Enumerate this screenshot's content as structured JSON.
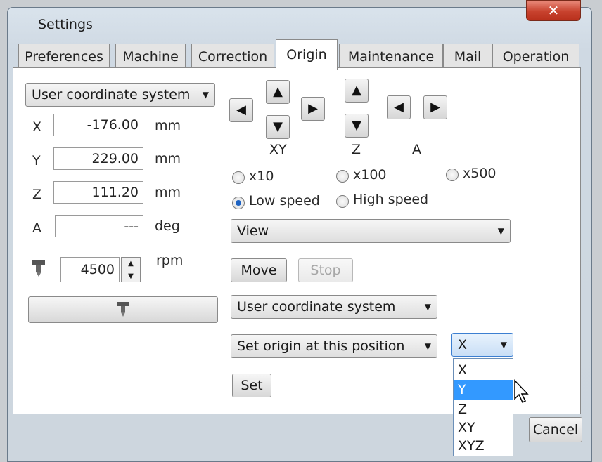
{
  "window": {
    "title": "Settings",
    "close_glyph": "✕"
  },
  "tabs": [
    {
      "label": "Preferences"
    },
    {
      "label": "Machine"
    },
    {
      "label": "Correction"
    },
    {
      "label": "Origin",
      "active": true
    },
    {
      "label": "Maintenance"
    },
    {
      "label": "Mail"
    },
    {
      "label": "Operation"
    }
  ],
  "left": {
    "coord_system": "User coordinate system",
    "axes": [
      {
        "axis": "X",
        "value": "-176.00",
        "unit": "mm"
      },
      {
        "axis": "Y",
        "value": "229.00",
        "unit": "mm"
      },
      {
        "axis": "Z",
        "value": "111.20",
        "unit": "mm"
      },
      {
        "axis": "A",
        "value": "---",
        "unit": "deg"
      }
    ],
    "spindle": {
      "value": "4500",
      "unit": "rpm",
      "icon": "spindle-icon"
    }
  },
  "jog": {
    "xy_label": "XY",
    "z_label": "Z",
    "a_label": "A",
    "up": "▲",
    "down": "▼",
    "left": "◀",
    "right": "▶"
  },
  "steps": {
    "x10": "x10",
    "x100": "x100",
    "x500": "x500",
    "low_speed": "Low speed",
    "high_speed": "High speed",
    "selected_speed": "Low speed"
  },
  "view_select": "View",
  "move_label": "Move",
  "stop_label": "Stop",
  "coord_system_select": "User coordinate system",
  "origin_action_select": "Set origin at this position",
  "axis_select": {
    "value": "X",
    "options": [
      "X",
      "Y",
      "Z",
      "XY",
      "XYZ"
    ],
    "highlighted": "Y"
  },
  "set_label": "Set",
  "cancel_label": "Cancel"
}
